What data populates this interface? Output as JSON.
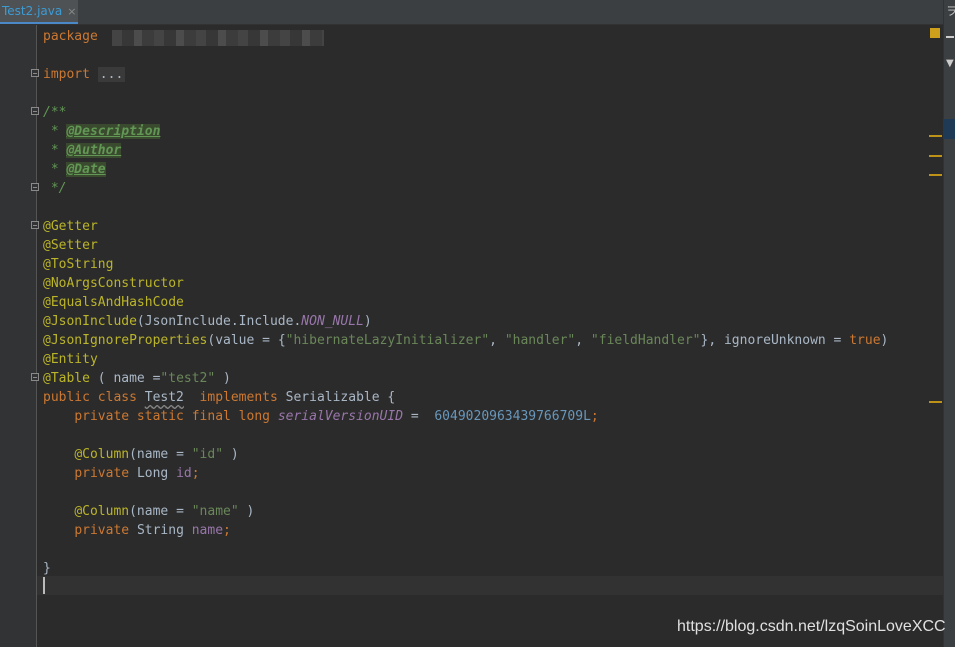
{
  "tab": {
    "label": "Test2.java",
    "close": "×"
  },
  "strip": {
    "glyph": "ヲ"
  },
  "code": {
    "l1": {
      "kw": "package"
    },
    "l3": {
      "kw": "import",
      "folded": "..."
    },
    "l5": {
      "text": "/**"
    },
    "l6": {
      "star": " * ",
      "tag": "@Description"
    },
    "l7": {
      "star": " * ",
      "tag": "@Author"
    },
    "l8": {
      "star": " * ",
      "tag": "@Date"
    },
    "l9": {
      "text": " */"
    },
    "l11": {
      "ann": "@Getter"
    },
    "l12": {
      "ann": "@Setter"
    },
    "l13": {
      "ann": "@ToString"
    },
    "l14": {
      "ann": "@NoArgsConstructor"
    },
    "l15": {
      "ann": "@EqualsAndHashCode"
    },
    "l16": {
      "ann": "@JsonInclude",
      "p1": "(JsonInclude.Include.",
      "const": "NON_NULL",
      "p2": ")"
    },
    "l17": {
      "ann": "@JsonIgnoreProperties",
      "p1": "(value = {",
      "s1": "\"hibernateLazyInitializer\"",
      "c1": ", ",
      "s2": "\"handler\"",
      "c2": ", ",
      "s3": "\"fieldHandler\"",
      "p2": "}, ignoreUnknown = ",
      "kw": "true",
      "p3": ")"
    },
    "l18": {
      "ann": "@Entity"
    },
    "l19": {
      "ann": "@Table",
      "p1": " ( name =",
      "s1": "\"test2\"",
      "p2": " )"
    },
    "l20": {
      "kw1": "public class ",
      "cls": "Test2",
      "kw2": "  implements ",
      "p1": "Serializable {"
    },
    "l21": {
      "indent": "    ",
      "kw": "private static final long ",
      "fld": "serialVersionUID",
      "p1": " =  ",
      "num": "6049020963439766709L",
      "p2": ";"
    },
    "l23": {
      "indent": "    ",
      "ann": "@Column",
      "p1": "(name = ",
      "s1": "\"id\"",
      "p2": " )"
    },
    "l24": {
      "indent": "    ",
      "kw": "private ",
      "p1": "Long ",
      "fld": "id",
      "p2": ";"
    },
    "l26": {
      "indent": "    ",
      "ann": "@Column",
      "p1": "(name = ",
      "s1": "\"name\"",
      "p2": " )"
    },
    "l27": {
      "indent": "    ",
      "kw": "private ",
      "p1": "String ",
      "fld": "name",
      "p2": ";"
    },
    "l29": {
      "text": "}"
    }
  },
  "watermark": "https://blog.csdn.net/lzqSoinLoveXCC",
  "colors": {
    "background": "#2b2b2b",
    "keyword": "#cc7832",
    "annotation": "#bbb529",
    "string": "#6a8759",
    "number": "#6897bb",
    "field": "#9876aa",
    "doc_comment": "#629755",
    "tab_accent": "#4a88c7"
  }
}
